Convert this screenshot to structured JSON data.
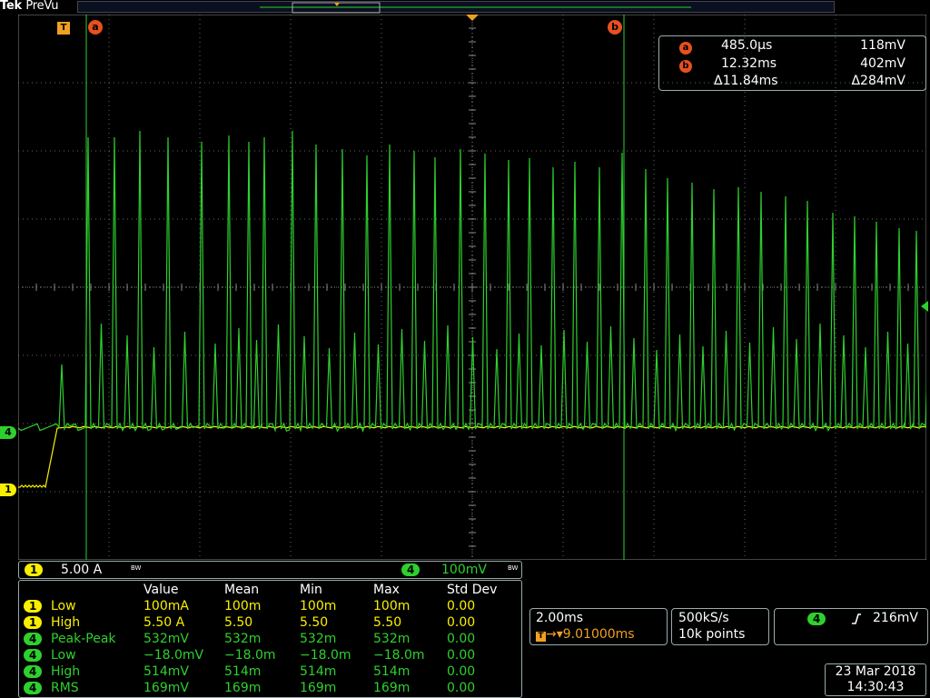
{
  "brand": {
    "name": "Tek",
    "mode": "PreVu"
  },
  "markers": {
    "trigger_letter": "T",
    "cursor_a": "a",
    "cursor_b": "b",
    "ch1_tag": "1",
    "ch4_tag": "4"
  },
  "cursor_readout": {
    "a": {
      "label": "a",
      "time": "485.0µs",
      "value": "118mV"
    },
    "b": {
      "label": "b",
      "time": "12.32ms",
      "value": "402mV"
    },
    "delta": {
      "time": "Δ11.84ms",
      "value": "Δ284mV"
    }
  },
  "channels": {
    "ch1": {
      "label": "1",
      "scale": "5.00 A",
      "bw": "BW",
      "color": "#f8f000"
    },
    "ch4": {
      "label": "4",
      "scale": "100mV",
      "bw": "BW",
      "color": "#2ed02e"
    }
  },
  "measurements": {
    "headers": [
      "Value",
      "Mean",
      "Min",
      "Max",
      "Std Dev"
    ],
    "rows": [
      {
        "ch": "1",
        "name": "Low",
        "value": "100mA",
        "mean": "100m",
        "min": "100m",
        "max": "100m",
        "std": "0.00"
      },
      {
        "ch": "1",
        "name": "High",
        "value": "5.50 A",
        "mean": "5.50",
        "min": "5.50",
        "max": "5.50",
        "std": "0.00"
      },
      {
        "ch": "4",
        "name": "Peak-Peak",
        "value": "532mV",
        "mean": "532m",
        "min": "532m",
        "max": "532m",
        "std": "0.00"
      },
      {
        "ch": "4",
        "name": "Low",
        "value": "−18.0mV",
        "mean": "−18.0m",
        "min": "−18.0m",
        "max": "−18.0m",
        "std": "0.00"
      },
      {
        "ch": "4",
        "name": "High",
        "value": "514mV",
        "mean": "514m",
        "min": "514m",
        "max": "514m",
        "std": "0.00"
      },
      {
        "ch": "4",
        "name": "RMS",
        "value": "169mV",
        "mean": "169m",
        "min": "169m",
        "max": "169m",
        "std": "0.00"
      }
    ]
  },
  "horizontal": {
    "timebase": "2.00ms",
    "trigger_pos": "9.01000ms"
  },
  "acquisition": {
    "rate": "500kS/s",
    "points": "10k points"
  },
  "trigger": {
    "source": "4",
    "slope_icon": "rising-edge",
    "level": "216mV"
  },
  "datetime": {
    "date": "23 Mar 2018",
    "time": "14:30:43"
  },
  "colors": {
    "ch1": "#f8f000",
    "ch4": "#2ed02e",
    "cursor": "#e8501e",
    "trigger": "#f0a020"
  }
}
